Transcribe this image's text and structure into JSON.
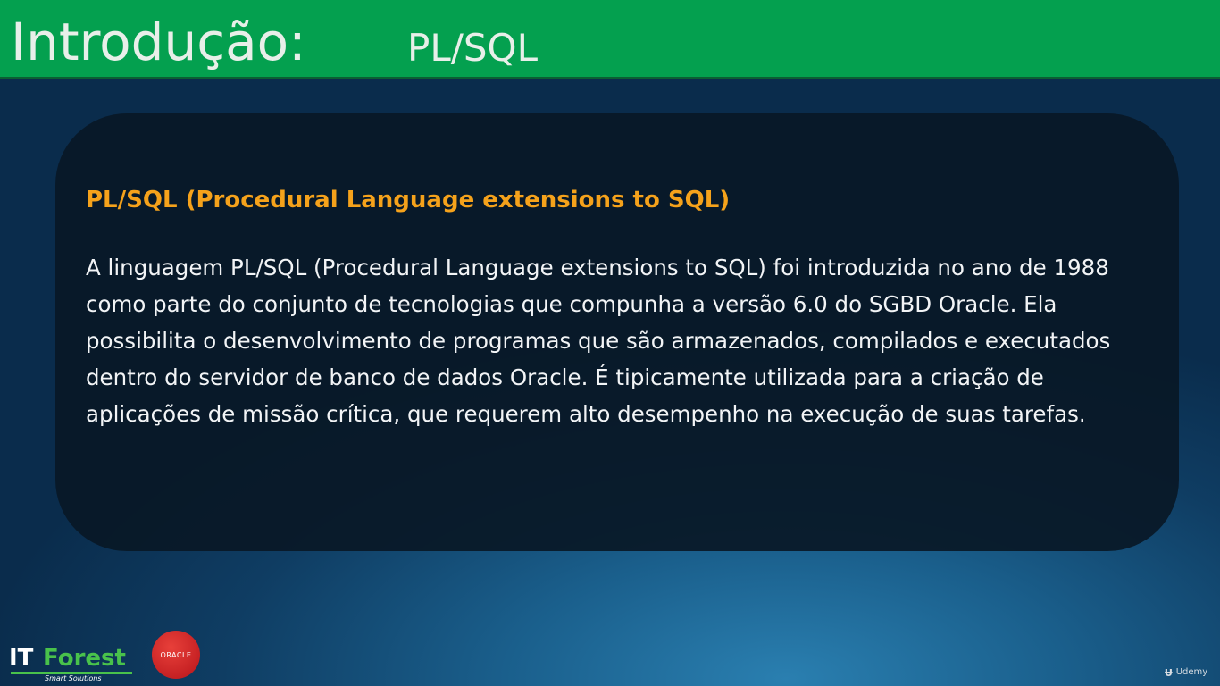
{
  "header": {
    "title": "Introdução:",
    "subtitle": "PL/SQL"
  },
  "content": {
    "heading": "PL/SQL (Procedural Language extensions to SQL)",
    "body": "A linguagem PL/SQL (Procedural Language extensions to SQL) foi introduzida no ano de 1988 como parte do conjunto de tecnologias que compunha a versão 6.0 do SGBD Oracle. Ela possibilita o desenvolvimento de programas que são armazenados, compilados e executados dentro do servidor de banco de dados Oracle. É tipicamente utilizada para a criação de aplicações de missão crítica, que requerem alto desempenho na execução de suas tarefas."
  },
  "logos": {
    "it_forest": {
      "it": "IT",
      "forest": "Forest",
      "tagline": "Smart Solutions"
    },
    "oracle": "ORACLE"
  },
  "watermark": {
    "icon": "udemy-icon",
    "text": "Udemy"
  },
  "colors": {
    "header_bg": "#04a04f",
    "heading": "#f5a21b",
    "body_text": "#f2f4f6",
    "box_bg": "#091826",
    "oracle_red": "#c8161d",
    "forest_green": "#49c24b"
  }
}
